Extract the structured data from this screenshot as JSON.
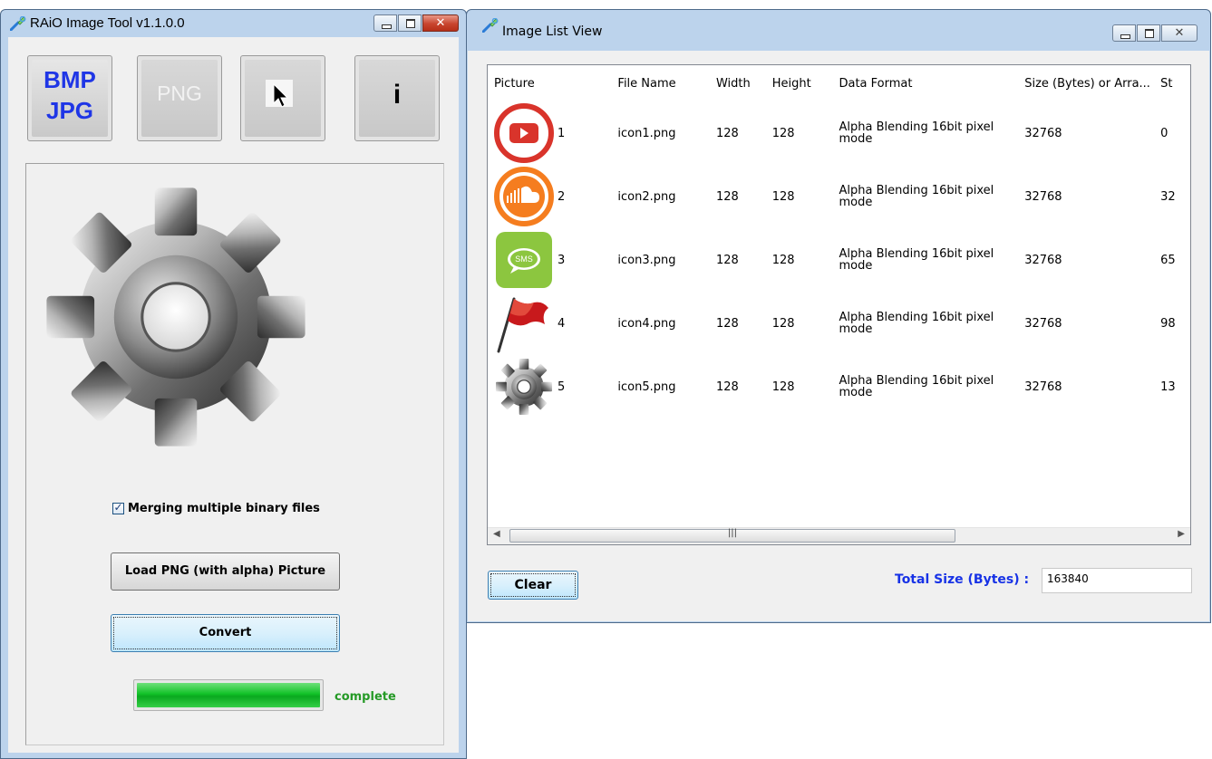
{
  "main_window": {
    "title": "RAiO Image Tool v1.1.0.0",
    "toolbar": {
      "bmp_line1": "BMP",
      "bmp_line2": "JPG",
      "png_label": "PNG",
      "info_label": "i"
    },
    "merge_checkbox": {
      "label": "Merging multiple binary files",
      "checked": true
    },
    "load_button": "Load PNG (with alpha) Picture",
    "convert_button": "Convert",
    "progress": {
      "value": 1.0
    },
    "status": "complete"
  },
  "list_window": {
    "title": "Image List View",
    "columns": [
      "Picture",
      "File Name",
      "Width",
      "Height",
      "Data Format",
      "Size (Bytes) or Arra...",
      "St"
    ],
    "rows": [
      {
        "num": "1",
        "icon": "youtube-icon",
        "file": "icon1.png",
        "width": "128",
        "height": "128",
        "format": "Alpha Blending 16bit pixel mode",
        "size": "32768",
        "start": "0"
      },
      {
        "num": "2",
        "icon": "soundcloud-icon",
        "file": "icon2.png",
        "width": "128",
        "height": "128",
        "format": "Alpha Blending 16bit pixel mode",
        "size": "32768",
        "start": "32"
      },
      {
        "num": "3",
        "icon": "sms-icon",
        "file": "icon3.png",
        "width": "128",
        "height": "128",
        "format": "Alpha Blending 16bit pixel mode",
        "size": "32768",
        "start": "65"
      },
      {
        "num": "4",
        "icon": "red-flag-icon",
        "file": "icon4.png",
        "width": "128",
        "height": "128",
        "format": "Alpha Blending 16bit pixel mode",
        "size": "32768",
        "start": "98"
      },
      {
        "num": "5",
        "icon": "gear-icon",
        "file": "icon5.png",
        "width": "128",
        "height": "128",
        "format": "Alpha Blending 16bit pixel mode",
        "size": "32768",
        "start": "13"
      }
    ],
    "clear_button": "Clear",
    "total_label": "Total Size (Bytes) :",
    "total_value": "163840"
  },
  "colors": {
    "title_blue": "#1732e6",
    "status_green": "#259a26",
    "progress_green": "#11c227",
    "window_frame": "#bcd3ec"
  }
}
